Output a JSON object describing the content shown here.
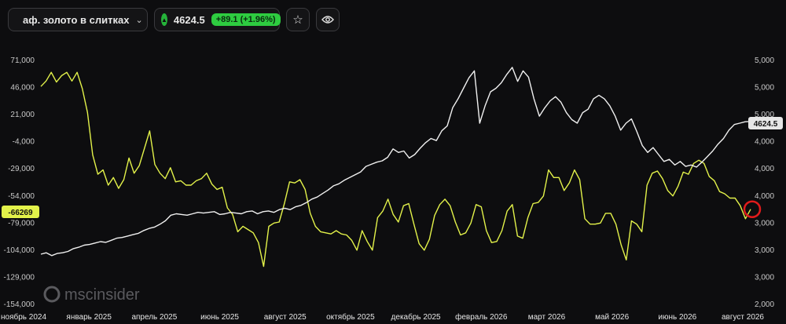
{
  "toolbar": {
    "asset_name": "аф. золото в слитках",
    "price": "4624.5",
    "change": "+89.1 (+1.96%)",
    "status_color": "#2ecc40"
  },
  "watermark": {
    "text": "mscinsider"
  },
  "chart_data": {
    "type": "line",
    "title": "",
    "x_labels": [
      "ноябрь 2024",
      "январь 2025",
      "апрель 2025",
      "июнь 2025",
      "август 2025",
      "октябрь 2025",
      "декабрь 2025",
      "февраль 2026",
      "март 2026",
      "май 2026",
      "июнь 2026",
      "август 2026"
    ],
    "left_axis": {
      "ticks": [
        "71,000",
        "46,000",
        "21,000",
        "-4,000",
        "-29,000",
        "-54,000",
        "-79,000",
        "-104,000",
        "-129,000",
        "-154,000"
      ],
      "range": [
        -154000,
        71000
      ]
    },
    "right_axis": {
      "ticks": [
        "5,000",
        "5,000",
        "5,000",
        "4,000",
        "4,000",
        "4,000",
        "3,000",
        "3,000",
        "3,000",
        "2,000"
      ],
      "range": [
        2000,
        5500
      ]
    },
    "last_left": "-66269",
    "last_right": "4624.5",
    "series": [
      {
        "axis": "left",
        "color": "#e3f24a",
        "values": [
          47000,
          52000,
          60000,
          51000,
          57000,
          60000,
          52000,
          60000,
          45000,
          23000,
          -16000,
          -34000,
          -30000,
          -44000,
          -37000,
          -47000,
          -39000,
          -19000,
          -33000,
          -26000,
          -10000,
          6000,
          -25000,
          -33000,
          -38000,
          -28000,
          -41000,
          -40000,
          -44000,
          -44000,
          -40000,
          -38000,
          -33000,
          -43000,
          -48000,
          -46000,
          -65000,
          -71000,
          -87000,
          -82000,
          -85000,
          -88000,
          -97000,
          -119000,
          -82000,
          -79000,
          -78000,
          -61000,
          -41000,
          -42000,
          -39000,
          -48000,
          -70000,
          -82000,
          -87000,
          -88000,
          -89000,
          -86000,
          -89000,
          -90000,
          -95000,
          -104000,
          -86000,
          -96000,
          -104000,
          -74000,
          -68000,
          -57000,
          -71000,
          -78000,
          -63000,
          -61000,
          -80000,
          -98000,
          -104000,
          -94000,
          -72000,
          -62000,
          -57000,
          -63000,
          -78000,
          -90000,
          -88000,
          -79000,
          -62000,
          -64000,
          -86000,
          -97000,
          -96000,
          -86000,
          -68000,
          -62000,
          -91000,
          -93000,
          -74000,
          -61000,
          -60000,
          -54000,
          -30000,
          -37000,
          -37000,
          -49000,
          -42000,
          -30000,
          -39000,
          -75000,
          -80000,
          -80000,
          -79000,
          -70000,
          -70000,
          -80000,
          -99000,
          -113000,
          -77000,
          -80000,
          -87000,
          -44000,
          -33000,
          -31000,
          -38000,
          -49000,
          -54000,
          -45000,
          -32000,
          -34000,
          -24000,
          -21000,
          -24000,
          -36000,
          -40000,
          -50000,
          -52000,
          -56000,
          -56000,
          -63000,
          -75000,
          -66269
        ]
      },
      {
        "axis": "right",
        "color": "#f0f0f0",
        "values": [
          2720,
          2740,
          2700,
          2730,
          2740,
          2760,
          2800,
          2820,
          2850,
          2860,
          2880,
          2900,
          2890,
          2920,
          2950,
          2960,
          2980,
          3000,
          3020,
          3060,
          3090,
          3110,
          3150,
          3200,
          3280,
          3300,
          3290,
          3280,
          3300,
          3320,
          3310,
          3320,
          3330,
          3290,
          3300,
          3320,
          3310,
          3300,
          3330,
          3340,
          3300,
          3330,
          3340,
          3320,
          3360,
          3380,
          3360,
          3400,
          3420,
          3460,
          3510,
          3540,
          3590,
          3640,
          3700,
          3730,
          3780,
          3820,
          3860,
          3900,
          3980,
          4010,
          4040,
          4060,
          4110,
          4230,
          4180,
          4200,
          4100,
          4150,
          4240,
          4320,
          4380,
          4350,
          4490,
          4560,
          4820,
          4950,
          5100,
          5250,
          5350,
          4600,
          4850,
          5050,
          5100,
          5180,
          5300,
          5400,
          5200,
          5350,
          5260,
          4950,
          4700,
          4820,
          4920,
          4980,
          4900,
          4750,
          4650,
          4600,
          4750,
          4800,
          4950,
          5000,
          4950,
          4850,
          4700,
          4500,
          4600,
          4660,
          4480,
          4280,
          4180,
          4250,
          4150,
          4050,
          4080,
          4000,
          4050,
          3980,
          4000,
          3970,
          4040,
          4120,
          4200,
          4300,
          4380,
          4500,
          4580,
          4600,
          4620,
          4624.5
        ]
      }
    ]
  }
}
